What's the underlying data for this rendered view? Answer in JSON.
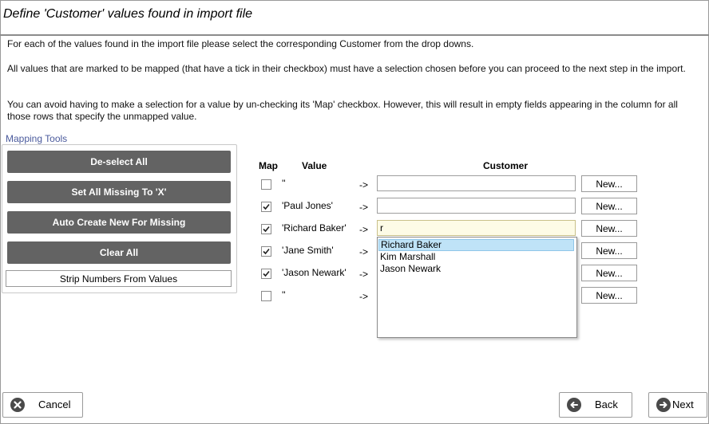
{
  "title": "Define 'Customer' values found in import file",
  "instructions": [
    "For each of the values found in the import file please select the corresponding Customer from the drop downs.",
    "All values that are marked to be mapped (that have a tick in their checkbox) must have a selection chosen before you can proceed to the next step in the import.",
    "You can avoid having to make a selection for a value by un-checking its 'Map' checkbox. However, this will result in empty fields appearing in the column for all those rows that specify the unmapped value."
  ],
  "mapping_tools": {
    "legend": "Mapping Tools",
    "deselect_all": "De-select All",
    "set_all_missing": "Set All Missing To 'X'",
    "auto_create": "Auto Create New For Missing",
    "clear_all": "Clear All",
    "strip_numbers": "Strip Numbers From Values"
  },
  "table": {
    "headers": {
      "map": "Map",
      "value": "Value",
      "customer": "Customer"
    },
    "arrow": "->",
    "new_label": "New...",
    "rows": [
      {
        "checked": false,
        "value": "''",
        "customer": ""
      },
      {
        "checked": true,
        "value": "'Paul Jones'",
        "customer": ""
      },
      {
        "checked": true,
        "value": "'Richard Baker'",
        "customer": "r"
      },
      {
        "checked": true,
        "value": "'Jane Smith'",
        "customer": ""
      },
      {
        "checked": true,
        "value": "'Jason Newark'",
        "customer": ""
      },
      {
        "checked": false,
        "value": "''",
        "customer": ""
      }
    ]
  },
  "dropdown": {
    "options": [
      "Richard Baker",
      "Kim Marshall",
      "Jason Newark"
    ],
    "selected": "Richard Baker"
  },
  "footer": {
    "cancel": "Cancel",
    "back": "Back",
    "next": "Next"
  }
}
